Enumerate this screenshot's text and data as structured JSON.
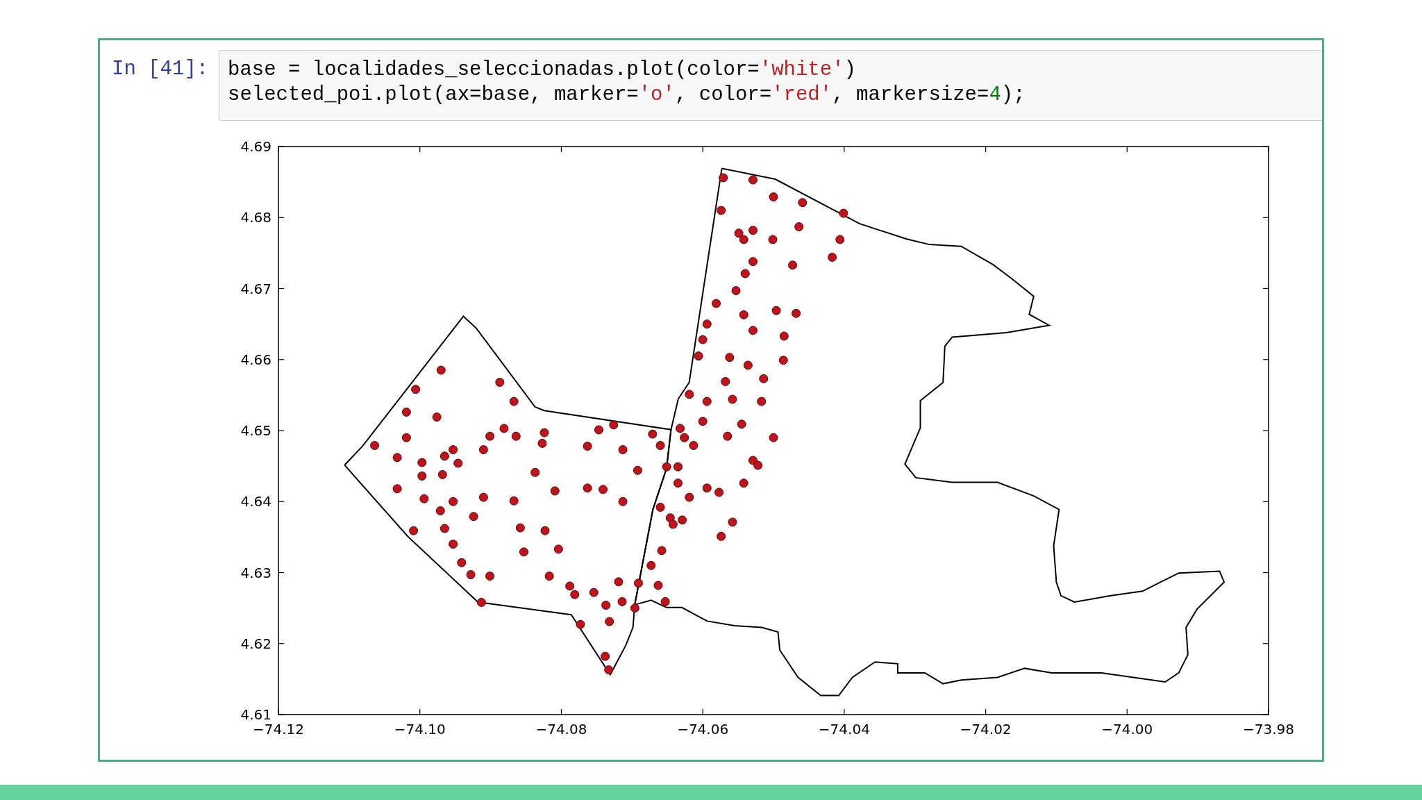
{
  "cell": {
    "prompt": "In [41]:",
    "code_lines": [
      [
        {
          "text": "base = localidades_seleccionadas.plot(color=",
          "kind": "plain"
        },
        {
          "text": "'white'",
          "kind": "string"
        },
        {
          "text": ")",
          "kind": "plain"
        }
      ],
      [
        {
          "text": "selected_poi.plot(ax=base, marker=",
          "kind": "plain"
        },
        {
          "text": "'o'",
          "kind": "string"
        },
        {
          "text": ", color=",
          "kind": "plain"
        },
        {
          "text": "'red'",
          "kind": "string"
        },
        {
          "text": ", markersize=",
          "kind": "plain"
        },
        {
          "text": "4",
          "kind": "number"
        },
        {
          "text": ");",
          "kind": "plain"
        }
      ]
    ],
    "chart_data": {
      "type": "scatter",
      "xlim": [
        -74.12,
        -73.98
      ],
      "ylim": [
        4.61,
        4.69
      ],
      "xticks": [
        {
          "value": -74.12,
          "label": "−74.12"
        },
        {
          "value": -74.1,
          "label": "−74.10"
        },
        {
          "value": -74.08,
          "label": "−74.08"
        },
        {
          "value": -74.06,
          "label": "−74.06"
        },
        {
          "value": -74.04,
          "label": "−74.04"
        },
        {
          "value": -74.02,
          "label": "−74.02"
        },
        {
          "value": -74.0,
          "label": "−74.00"
        },
        {
          "value": -73.98,
          "label": "−73.98"
        }
      ],
      "yticks": [
        {
          "value": 4.61,
          "label": "4.61"
        },
        {
          "value": 4.62,
          "label": "4.62"
        },
        {
          "value": 4.63,
          "label": "4.63"
        },
        {
          "value": 4.64,
          "label": "4.64"
        },
        {
          "value": 4.65,
          "label": "4.65"
        },
        {
          "value": 4.66,
          "label": "4.66"
        },
        {
          "value": 4.67,
          "label": "4.67"
        },
        {
          "value": 4.68,
          "label": "4.68"
        },
        {
          "value": 4.69,
          "label": "4.69"
        }
      ],
      "x": [
        -74.097,
        -74.1006,
        -74.0887,
        -74.0867,
        -74.1019,
        -74.0976,
        -74.1064,
        -74.1019,
        -74.1032,
        -74.0997,
        -74.0965,
        -74.0953,
        -74.0946,
        -74.091,
        -74.0997,
        -74.0968,
        -74.1032,
        -74.0994,
        -74.0953,
        -74.091,
        -74.0971,
        -74.1009,
        -74.0965,
        -74.0953,
        -74.0924,
        -74.0867,
        -74.0881,
        -74.0864,
        -74.0824,
        -74.0827,
        -74.0837,
        -74.0809,
        -74.0763,
        -74.0741,
        -74.0713,
        -74.0823,
        -74.0804,
        -74.0853,
        -74.0817,
        -74.0788,
        -74.0781,
        -74.0773,
        -74.0754,
        -74.0737,
        -74.0732,
        -74.0714,
        -74.0738,
        -74.0733,
        -74.0719,
        -74.0696,
        -74.0691,
        -74.0747,
        -74.0726,
        -74.0763,
        -74.0713,
        -74.0692,
        -74.0671,
        -74.066,
        -74.0651,
        -74.066,
        -74.0646,
        -74.0629,
        -74.0658,
        -74.0673,
        -74.0663,
        -74.0653,
        -74.0901,
        -74.0858,
        -74.0941,
        -74.0928,
        -74.0901,
        -74.0913,
        -74.0571,
        -74.0529,
        -74.05,
        -74.0459,
        -74.0401,
        -74.0574,
        -74.0529,
        -74.0542,
        -74.0501,
        -74.0464,
        -74.0529,
        -74.0473,
        -74.0417,
        -74.0406,
        -74.054,
        -74.0553,
        -74.0581,
        -74.0542,
        -74.0496,
        -74.0468,
        -74.0485,
        -74.0594,
        -74.06,
        -74.0562,
        -74.0529,
        -74.0606,
        -74.0568,
        -74.0536,
        -74.0514,
        -74.0619,
        -74.0594,
        -74.0558,
        -74.06,
        -74.0565,
        -74.0545,
        -74.05,
        -74.0626,
        -74.0613,
        -74.0635,
        -74.0619,
        -74.0594,
        -74.0577,
        -74.0558,
        -74.0574,
        -74.0529,
        -74.0522,
        -74.0542,
        -74.0517,
        -74.0486,
        -74.0549,
        -74.0635,
        -74.0642,
        -74.0632
      ],
      "series": [
        {
          "color": "#c0141c",
          "values": [
            4.6585,
            4.6558,
            4.6568,
            4.6541,
            4.6526,
            4.6519,
            4.6479,
            4.649,
            4.6462,
            4.6455,
            4.6464,
            4.6473,
            4.6454,
            4.6473,
            4.6436,
            4.6438,
            4.6418,
            4.6404,
            4.64,
            4.6406,
            4.6387,
            4.6359,
            4.6362,
            4.634,
            4.6379,
            4.6401,
            4.6503,
            4.6492,
            4.6497,
            4.6482,
            4.6441,
            4.6415,
            4.6419,
            4.6417,
            4.64,
            4.6359,
            4.6333,
            4.6329,
            4.6295,
            4.6281,
            4.6269,
            4.6227,
            4.6272,
            4.6254,
            4.6231,
            4.6259,
            4.6182,
            4.6163,
            4.6287,
            4.625,
            4.6285,
            4.6501,
            4.6508,
            4.6478,
            4.6473,
            4.6444,
            4.6495,
            4.6479,
            4.6449,
            4.6392,
            4.6377,
            4.6374,
            4.6331,
            4.631,
            4.6282,
            4.6259,
            4.6492,
            4.6363,
            4.6314,
            4.6297,
            4.6295,
            4.6258,
            4.6856,
            4.6853,
            4.6829,
            4.6821,
            4.6806,
            4.681,
            4.6782,
            4.6769,
            4.6769,
            4.6787,
            4.6738,
            4.6733,
            4.6744,
            4.6769,
            4.6721,
            4.6697,
            4.6679,
            4.6663,
            4.6669,
            4.6665,
            4.6633,
            4.665,
            4.6628,
            4.6603,
            4.6641,
            4.6605,
            4.6569,
            4.6592,
            4.6573,
            4.6551,
            4.6541,
            4.6544,
            4.6513,
            4.6492,
            4.6509,
            4.649,
            4.649,
            4.6479,
            4.6449,
            4.6406,
            4.6419,
            4.6413,
            4.6371,
            4.6351,
            4.6458,
            4.6451,
            4.6426,
            4.6541,
            4.6599,
            4.6778,
            4.6426,
            4.6368,
            4.6503
          ]
        }
      ]
    }
  }
}
